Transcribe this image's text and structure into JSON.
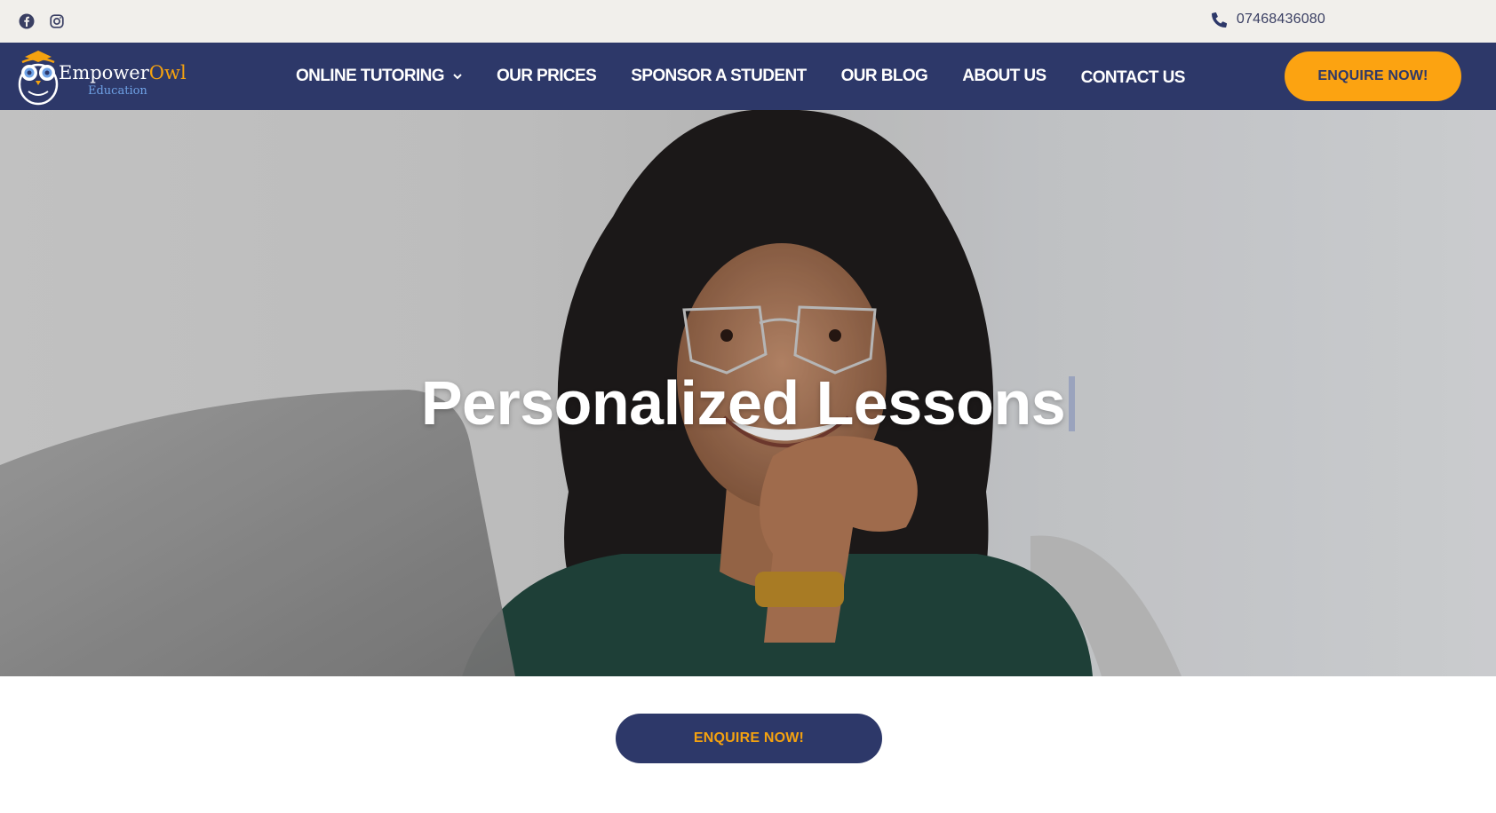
{
  "topbar": {
    "social": [
      {
        "icon": "facebook-icon"
      },
      {
        "icon": "instagram-icon"
      }
    ],
    "phone": "07468436080",
    "phone_icon": "phone-icon"
  },
  "header": {
    "logo": {
      "word_primary": "Empower",
      "word_accent": "Owl",
      "subtitle": "Education"
    },
    "nav": [
      {
        "label": "ONLINE TUTORING",
        "has_dropdown": true
      },
      {
        "label": "OUR PRICES"
      },
      {
        "label": "SPONSOR A STUDENT"
      },
      {
        "label": "OUR BLOG"
      },
      {
        "label": "ABOUT US"
      },
      {
        "label": "CONTACT US"
      }
    ],
    "cta_label": "ENQUIRE NOW!"
  },
  "hero": {
    "title": "Personalized Lessons"
  },
  "cta_bottom_label": "ENQUIRE NOW!",
  "colors": {
    "navy": "#2d3869",
    "orange": "#fca311",
    "topbar_bg": "#f1efeb",
    "white": "#ffffff"
  }
}
